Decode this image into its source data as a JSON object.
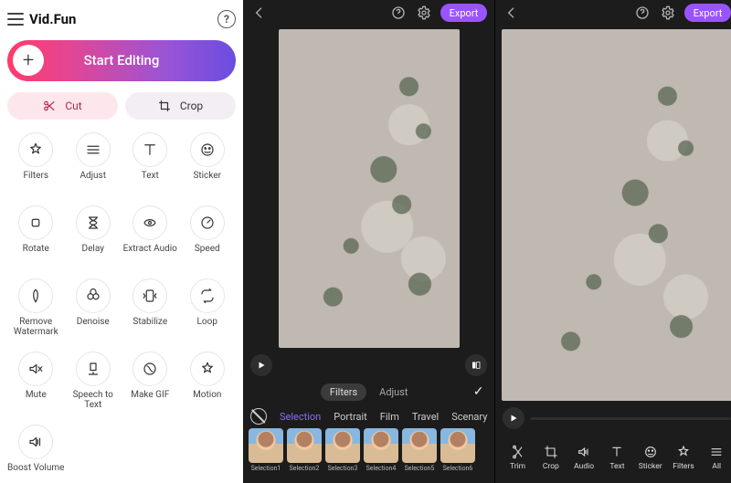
{
  "left": {
    "brand": "Vid.Fun",
    "start_label": "Start Editing",
    "cut_label": "Cut",
    "crop_label": "Crop",
    "tools": [
      {
        "key": "filters",
        "label": "Filters"
      },
      {
        "key": "adjust",
        "label": "Adjust"
      },
      {
        "key": "text",
        "label": "Text"
      },
      {
        "key": "sticker",
        "label": "Sticker"
      },
      {
        "key": "rotate",
        "label": "Rotate"
      },
      {
        "key": "delay",
        "label": "Delay"
      },
      {
        "key": "extract",
        "label": "Extract Audio"
      },
      {
        "key": "speed",
        "label": "Speed"
      },
      {
        "key": "rmwm",
        "label": "Remove\nWatermark"
      },
      {
        "key": "denoise",
        "label": "Denoise"
      },
      {
        "key": "stabilize",
        "label": "Stabilize"
      },
      {
        "key": "loop",
        "label": "Loop"
      },
      {
        "key": "mute",
        "label": "Mute"
      },
      {
        "key": "stt",
        "label": "Speech to\nText"
      },
      {
        "key": "gif",
        "label": "Make GIF"
      },
      {
        "key": "motion",
        "label": "Motion"
      },
      {
        "key": "boost",
        "label": "Boost Volume"
      }
    ]
  },
  "editor": {
    "export_label": "Export",
    "tabs": {
      "filters": "Filters",
      "adjust": "Adjust"
    },
    "categories": [
      "Selection",
      "Portrait",
      "Film",
      "Travel",
      "Scenary"
    ],
    "thumbs": [
      "Selection1",
      "Selection2",
      "Selection3",
      "Selection4",
      "Selection5",
      "Selection6"
    ],
    "bottom_tools": [
      "Trim",
      "Crop",
      "Audio",
      "Text",
      "Sticker",
      "Filters",
      "All"
    ]
  }
}
